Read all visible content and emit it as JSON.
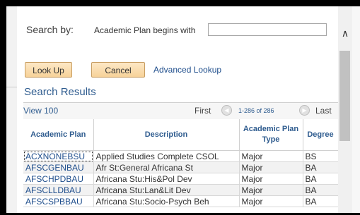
{
  "search": {
    "label": "Search by:",
    "criteria": "Academic Plan begins with",
    "value": ""
  },
  "buttons": {
    "lookup": "Look Up",
    "cancel": "Cancel",
    "advanced": "Advanced Lookup"
  },
  "results": {
    "title": "Search Results",
    "view_link": "View 100",
    "first": "First",
    "range": "1-286 of 286",
    "last": "Last",
    "columns": [
      "Academic Plan",
      "Description",
      "Academic Plan Type",
      "Degree"
    ],
    "rows": [
      [
        "ACXNONEBSU",
        "Applied Studies Complete CSOL",
        "Major",
        "BS"
      ],
      [
        "AFSCGENBAU",
        "Afr St:General Africana St",
        "Major",
        "BA"
      ],
      [
        "AFSCHPDBAU",
        "Africana Stu:His&Pol Dev",
        "Major",
        "BA"
      ],
      [
        "AFSCLLDBAU",
        "Africana Stu:Lan&Lit Dev",
        "Major",
        "BA"
      ],
      [
        "AFSCSPBBAU",
        "Africana Stu:Socio-Psych Beh",
        "Major",
        "BA"
      ]
    ]
  },
  "icons": {
    "prev": "circle-left-arrow-icon",
    "next": "circle-right-arrow-icon",
    "scroll_up": "chevron-up-icon"
  }
}
